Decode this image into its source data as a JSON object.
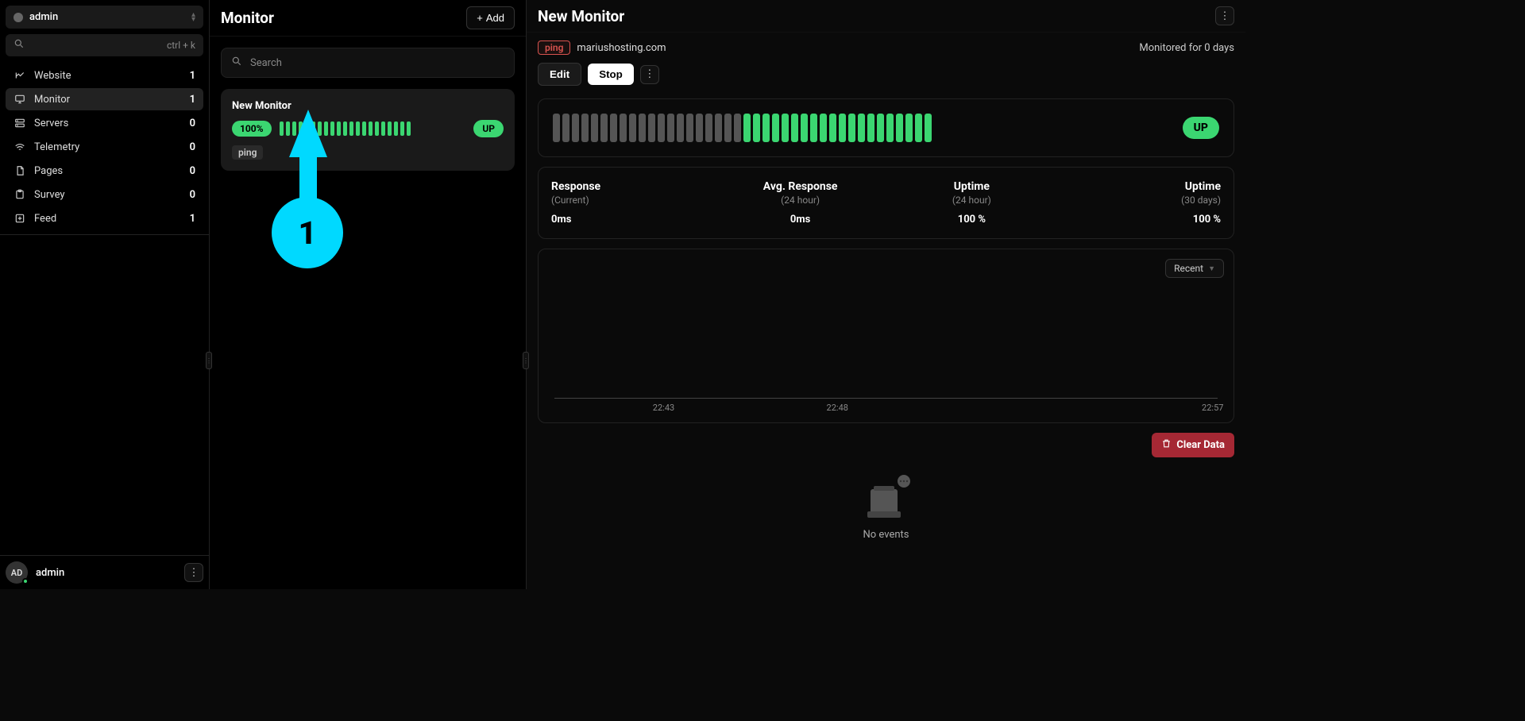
{
  "workspace": {
    "name": "admin"
  },
  "search": {
    "shortcut": "ctrl + k",
    "placeholder": "Search"
  },
  "nav": {
    "items": [
      {
        "label": "Website",
        "count": "1",
        "active": false,
        "icon": "chart"
      },
      {
        "label": "Monitor",
        "count": "1",
        "active": true,
        "icon": "monitor"
      },
      {
        "label": "Servers",
        "count": "0",
        "active": false,
        "icon": "servers"
      },
      {
        "label": "Telemetry",
        "count": "0",
        "active": false,
        "icon": "wifi"
      },
      {
        "label": "Pages",
        "count": "0",
        "active": false,
        "icon": "pages"
      },
      {
        "label": "Survey",
        "count": "0",
        "active": false,
        "icon": "survey"
      },
      {
        "label": "Feed",
        "count": "1",
        "active": false,
        "icon": "feed"
      }
    ]
  },
  "user": {
    "initials": "AD",
    "name": "admin"
  },
  "mid": {
    "title": "Monitor",
    "add_label": "Add",
    "search_placeholder": "Search",
    "card": {
      "name": "New Monitor",
      "percent": "100%",
      "status": "UP",
      "tags": [
        "ping"
      ],
      "bar_count": 21
    }
  },
  "annotation": {
    "number": "1"
  },
  "detail": {
    "title": "New Monitor",
    "type_tag": "ping",
    "host": "mariushosting.com",
    "monitored_for": "Monitored for 0 days",
    "edit_label": "Edit",
    "stop_label": "Stop",
    "bars": {
      "gray": 20,
      "green": 20
    },
    "status": "UP",
    "stats": [
      {
        "label": "Response",
        "sub": "(Current)",
        "value": "0ms"
      },
      {
        "label": "Avg. Response",
        "sub": "(24 hour)",
        "value": "0ms"
      },
      {
        "label": "Uptime",
        "sub": "(24 hour)",
        "value": "100 %"
      },
      {
        "label": "Uptime",
        "sub": "(30 days)",
        "value": "100 %"
      }
    ],
    "chart": {
      "range_label": "Recent",
      "ticks": [
        "22:43",
        "22:48",
        "22:57"
      ]
    },
    "clear_label": "Clear Data",
    "no_events": "No events"
  }
}
